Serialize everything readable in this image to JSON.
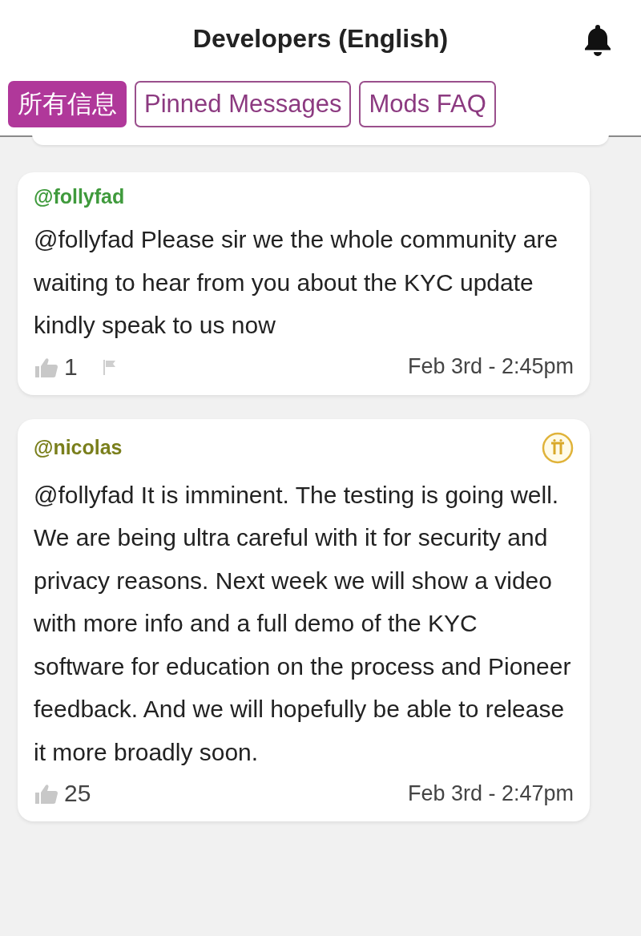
{
  "header": {
    "title": "Developers (English)"
  },
  "tabs": [
    {
      "label": "所有信息",
      "selected": true
    },
    {
      "label": "Pinned Messages",
      "selected": false
    },
    {
      "label": "Mods FAQ",
      "selected": false
    }
  ],
  "messages": [
    {
      "author": "@follyfad",
      "color": "#3f9a3c",
      "verified": false,
      "text": "@follyfad Please sir we the whole community are waiting to hear from you about the KYC update kindly speak to us now",
      "likes": "1",
      "flag": true,
      "time": "Feb 3rd - 2:45pm"
    },
    {
      "author": "@nicolas",
      "color": "#7a7f1c",
      "verified": true,
      "text": "@follyfad It is imminent. The testing is going well. We are being ultra careful with it for security and privacy reasons. Next week we will show a video with more info and a full demo of the KYC software for education on the process and Pioneer feedback. And we will hopefully be able to release it more broadly soon.",
      "likes": "25",
      "flag": false,
      "time": "Feb 3rd - 2:47pm"
    }
  ]
}
